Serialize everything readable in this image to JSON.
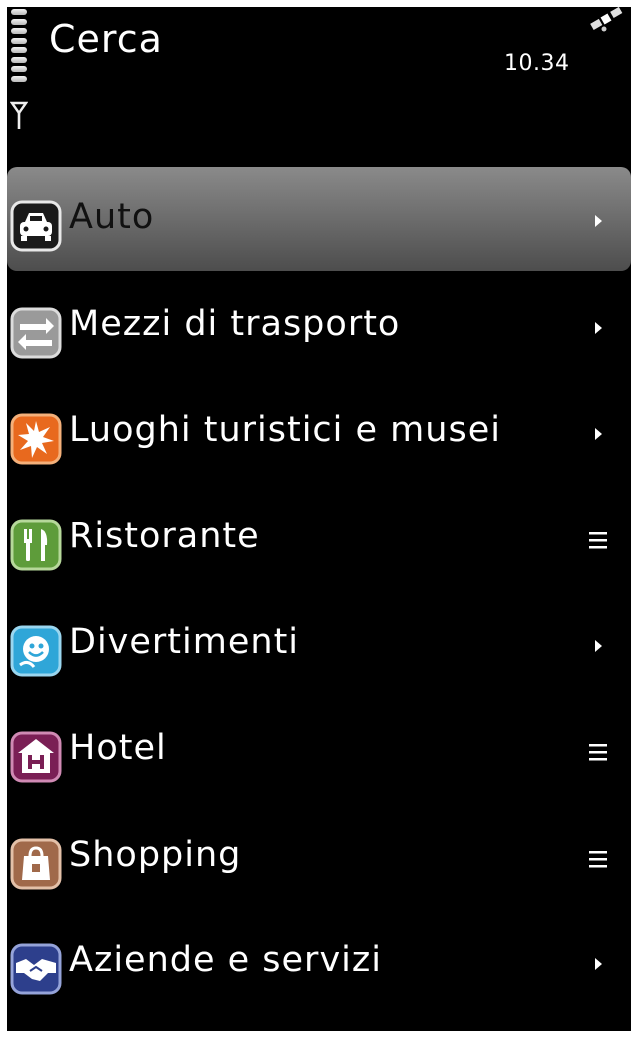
{
  "header": {
    "title": "Cerca",
    "clock": "10.34"
  },
  "status": {
    "battery_icon": "battery-icon",
    "signal_icon": "signal-antenna-icon",
    "gps_icon": "gps-satellite-icon"
  },
  "menu": {
    "items": [
      {
        "label": "Auto",
        "icon": "car-icon",
        "indicator": "submenu-arrow",
        "selected": true
      },
      {
        "label": "Mezzi di trasporto",
        "icon": "transport-arrows-icon",
        "indicator": "submenu-arrow",
        "selected": false
      },
      {
        "label": "Luoghi turistici e musei",
        "icon": "attraction-burst-icon",
        "indicator": "submenu-arrow",
        "selected": false
      },
      {
        "label": "Ristorante",
        "icon": "fork-knife-icon",
        "indicator": "list-icon",
        "selected": false
      },
      {
        "label": "Divertimenti",
        "icon": "entertainment-icon",
        "indicator": "submenu-arrow",
        "selected": false
      },
      {
        "label": "Hotel",
        "icon": "hotel-icon",
        "indicator": "list-icon",
        "selected": false
      },
      {
        "label": "Shopping",
        "icon": "shopping-bag-icon",
        "indicator": "list-icon",
        "selected": false
      },
      {
        "label": "Aziende e servizi",
        "icon": "handshake-icon",
        "indicator": "submenu-arrow",
        "selected": false
      }
    ]
  },
  "colors": {
    "background": "#000000",
    "selection": "#6c6c6c",
    "text": "#ffffff"
  }
}
